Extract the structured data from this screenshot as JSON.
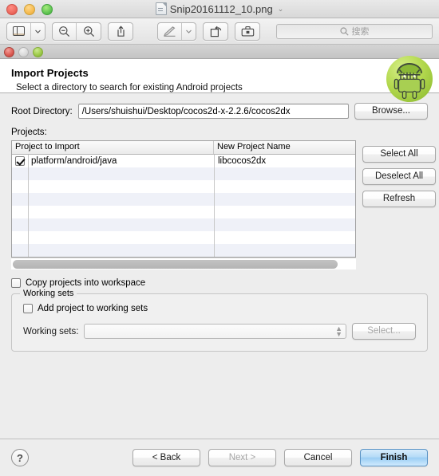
{
  "preview_window": {
    "title": "Snip20161112_10.png",
    "title_icon": "document-icon",
    "title_chevron": "⌄",
    "toolbar": {
      "sidebar_icon": "sidebar-icon",
      "sidebar_chevron": "⌄",
      "zoom_out_icon": "zoom-out-icon",
      "zoom_in_icon": "zoom-in-icon",
      "share_icon": "share-icon",
      "markup_icon": "markup-pen-icon",
      "markup_chevron": "⌄",
      "rotate_icon": "rotate-left-icon",
      "toolbox_icon": "toolbox-icon",
      "search_icon": "search-icon",
      "search_placeholder": "搜索"
    }
  },
  "dialog": {
    "header": {
      "title": "Import Projects",
      "subtitle": "Select a directory to search for existing Android projects",
      "logo": "android-logo-icon"
    },
    "root_directory": {
      "label": "Root Directory:",
      "value": "/Users/shuishui/Desktop/cocos2d-x-2.2.6/cocos2dx",
      "browse_label": "Browse..."
    },
    "projects": {
      "label": "Projects:",
      "columns": [
        "Project to Import",
        "New Project Name"
      ],
      "rows": [
        {
          "checked": true,
          "project": "platform/android/java",
          "new_name": "libcocos2dx"
        }
      ],
      "empty_row_count": 7,
      "buttons": {
        "select_all": "Select All",
        "deselect_all": "Deselect All",
        "refresh": "Refresh"
      },
      "scrollbar": "horizontal-scrollbar"
    },
    "copy_into_workspace": {
      "label": "Copy projects into workspace",
      "checked": false
    },
    "working_sets": {
      "group_title": "Working sets",
      "add_checkbox_label": "Add project to working sets",
      "add_checked": false,
      "combo_label": "Working sets:",
      "combo_value": "",
      "select_label": "Select..."
    },
    "footer": {
      "help_icon": "?",
      "back": "< Back",
      "next": "Next >",
      "cancel": "Cancel",
      "finish": "Finish"
    }
  },
  "colors": {
    "default_button_blue": "#9bcef4",
    "android_green": "#9bc63c",
    "row_stripe": "#eff1f8"
  }
}
